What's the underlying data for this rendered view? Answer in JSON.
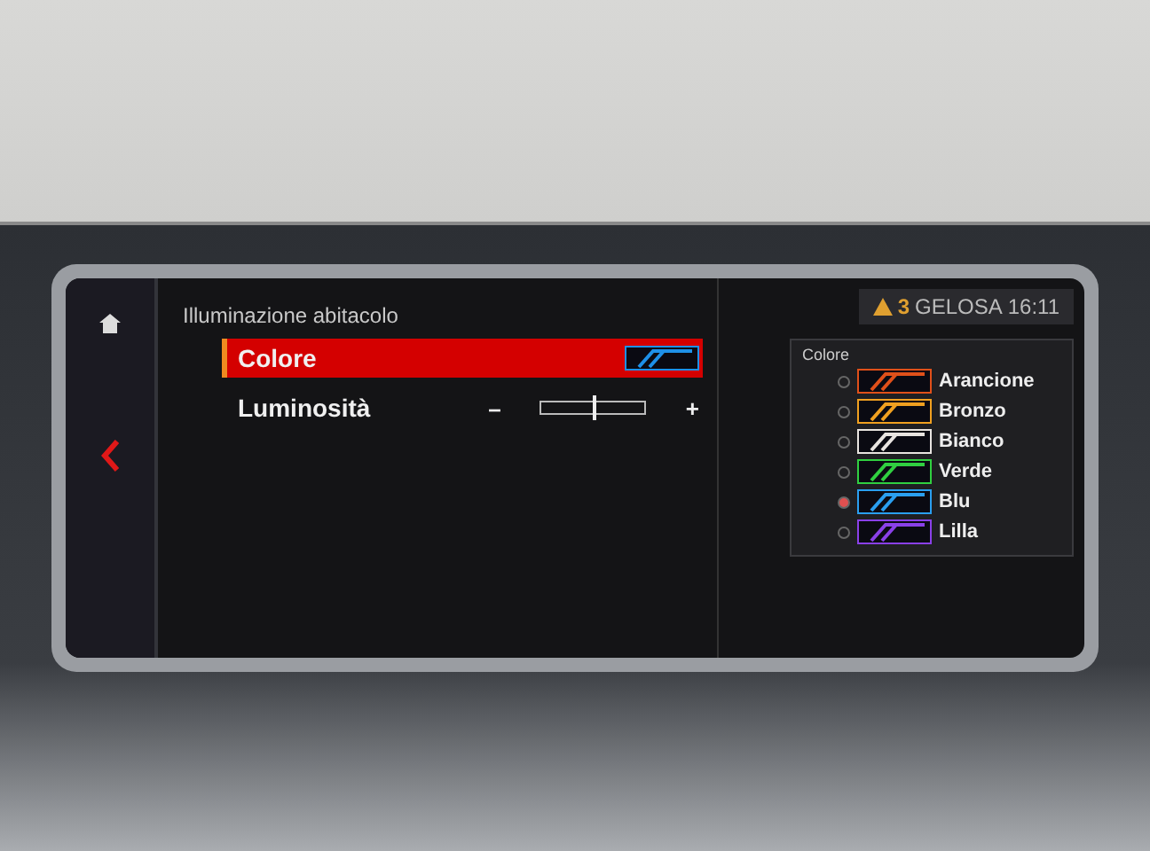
{
  "header": {
    "title": "Illuminazione abitacolo"
  },
  "menu": [
    {
      "kind": "swatch",
      "label": "Colore",
      "selected": true,
      "color": "#1e90e8"
    },
    {
      "kind": "slider",
      "label": "Luminosità",
      "selected": false,
      "minus": "–",
      "plus": "+",
      "level": 0.5
    }
  ],
  "status": {
    "warning_count": "3",
    "location": "GELOSA",
    "time": "16:11"
  },
  "color_list": {
    "title": "Colore",
    "options": [
      {
        "label": "Arancione",
        "color": "#e0501a",
        "selected": false
      },
      {
        "label": "Bronzo",
        "color": "#f0a020",
        "selected": false
      },
      {
        "label": "Bianco",
        "color": "#e8e4e0",
        "selected": false
      },
      {
        "label": "Verde",
        "color": "#30d040",
        "selected": false
      },
      {
        "label": "Blu",
        "color": "#2a9ff0",
        "selected": true
      },
      {
        "label": "Lilla",
        "color": "#8a40e8",
        "selected": false
      }
    ]
  }
}
